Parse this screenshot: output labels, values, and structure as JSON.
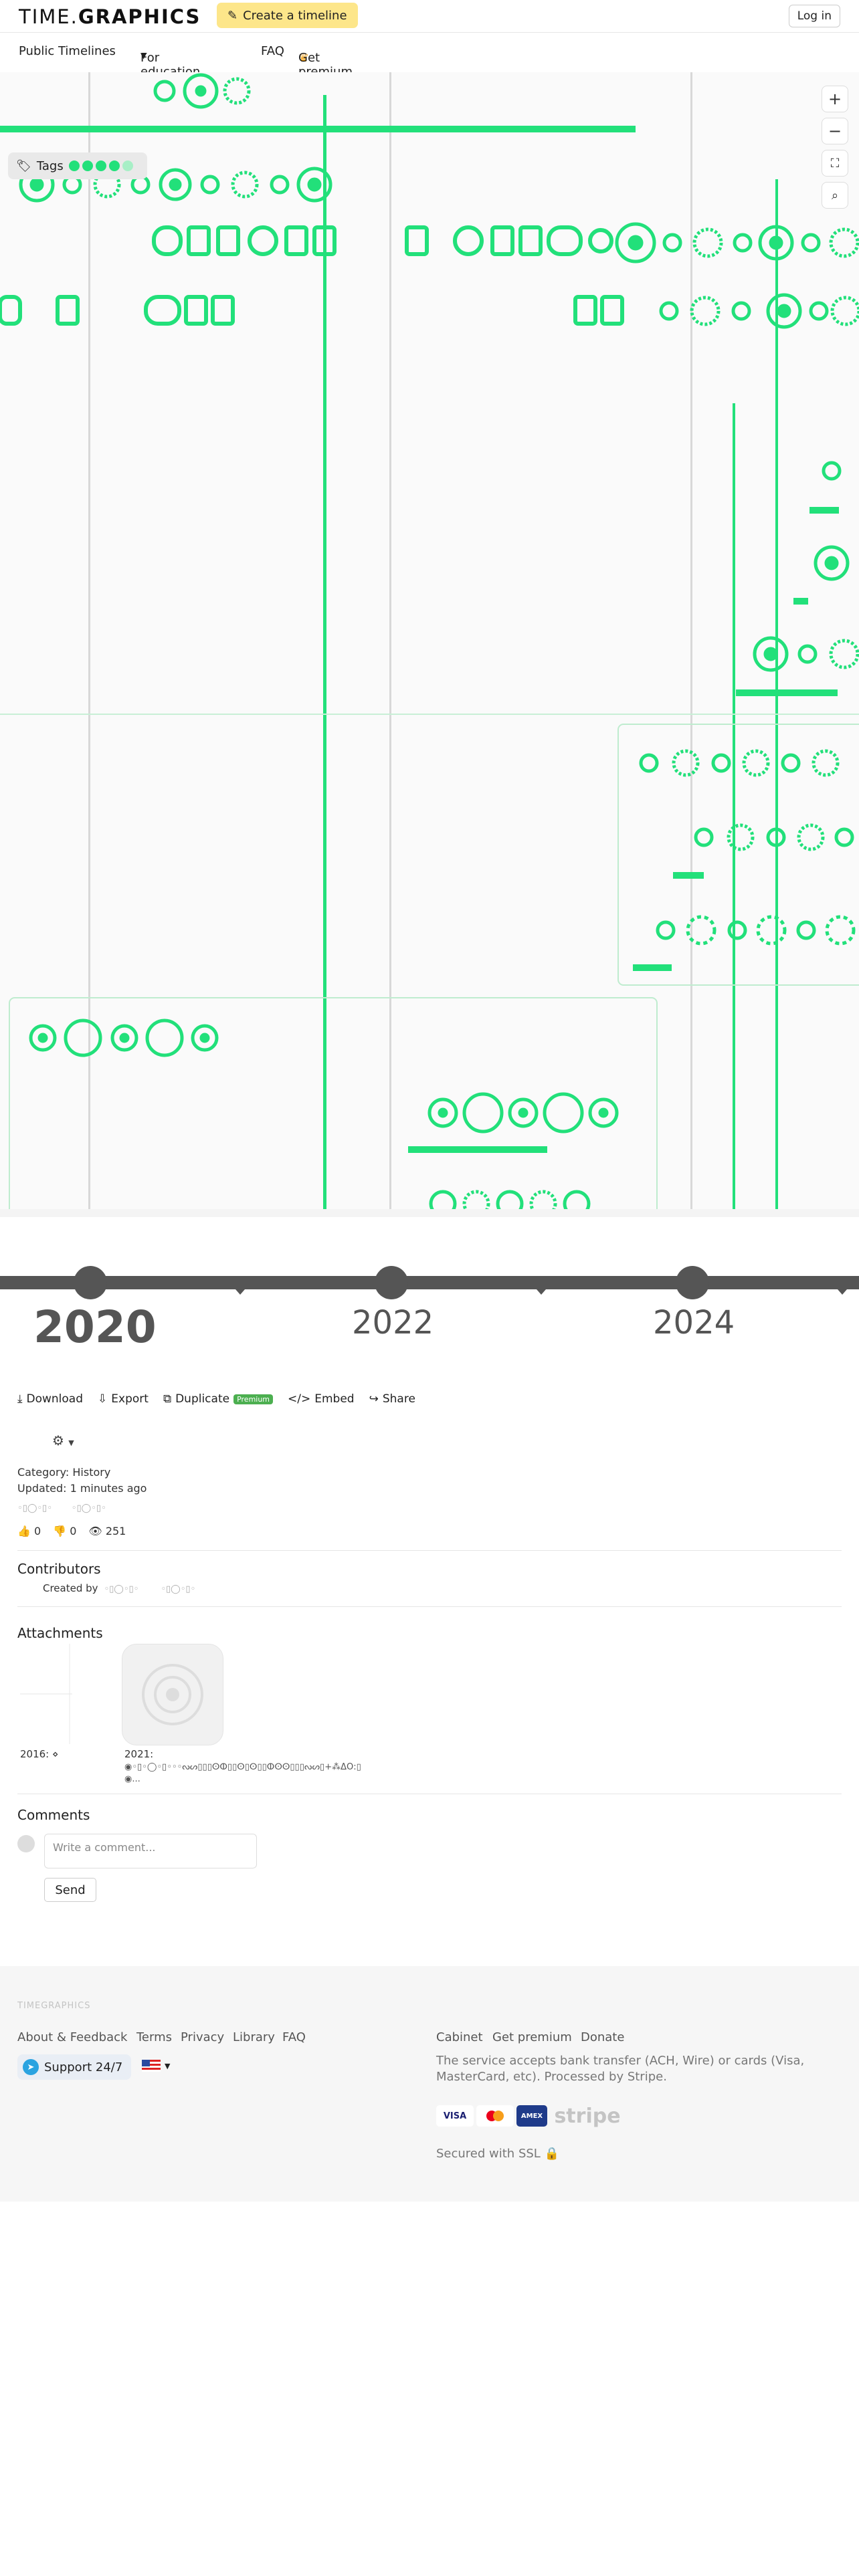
{
  "header": {
    "logo_a": "TIME.",
    "logo_b": "GRAPHICS",
    "create_label": "Create a timeline",
    "login_label": "Log in"
  },
  "nav": {
    "public": "Public Timelines",
    "education": "For education",
    "faq": "FAQ",
    "premium": "Get premium"
  },
  "canvas": {
    "tags_label": "Tags",
    "accent": "#22e07a",
    "years": [
      "2020",
      "2022",
      "2024"
    ]
  },
  "actions": {
    "download": "Download",
    "export": "Export",
    "duplicate": "Duplicate",
    "premium_badge": "Premium",
    "embed": "Embed",
    "share": "Share"
  },
  "info": {
    "category": "Category: History",
    "updated": "Updated: 1 minutes ago",
    "likes": "0",
    "dislikes": "0",
    "views": "251"
  },
  "contributors": {
    "title": "Contributors",
    "created_by": "Created by"
  },
  "attachments": {
    "title": "Attachments",
    "item1": "2016: ⋄",
    "item2": "2021:"
  },
  "comments": {
    "title": "Comments",
    "placeholder": "Write a comment...",
    "send": "Send"
  },
  "footer": {
    "brand": "TIMEGRAPHICS",
    "links_left": [
      "About & Feedback",
      "Terms",
      "Privacy",
      "Library",
      "FAQ"
    ],
    "links_right": [
      "Cabinet",
      "Get premium",
      "Donate"
    ],
    "support": "Support 24/7",
    "pay_text": "The service accepts bank transfer (ACH, Wire) or cards (Visa, MasterCard, etc). Processed by Stripe.",
    "cards": [
      "VISA",
      "AMEX",
      "stripe"
    ],
    "ssl": "Secured with SSL"
  }
}
